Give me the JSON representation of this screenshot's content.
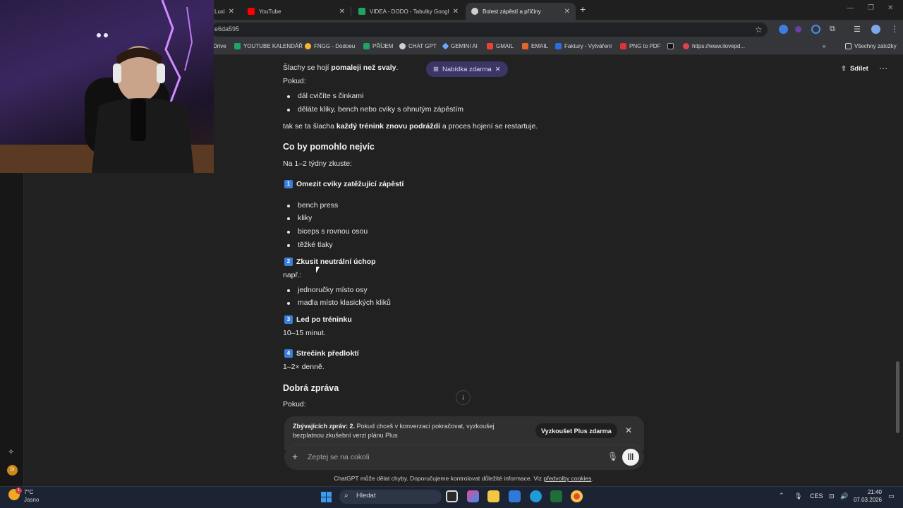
{
  "browser": {
    "tabs": [
      {
        "label": "Luxi",
        "favicon_color": "#6a6a6a"
      },
      {
        "label": "YouTube",
        "favicon_color": "#ff0000"
      },
      {
        "label": "VIDEA - DODO - Tabulky Googl",
        "favicon_color": "#1fa463"
      },
      {
        "label": "Bolest zápěstí a příčiny",
        "favicon_color": "#cfcfcf"
      }
    ],
    "address": "e6da595",
    "bookmarks": [
      {
        "label": "Drive",
        "color": "#1e88e5"
      },
      {
        "label": "YOUTUBE KALENDÁŘ",
        "color": "#1fa463"
      },
      {
        "label": "FNGG - Dodoeu",
        "color": "#f2b632"
      },
      {
        "label": "PŘÍJEM",
        "color": "#1fa463"
      },
      {
        "label": "CHAT GPT",
        "color": "#cfcfcf"
      },
      {
        "label": "GEMINI AI",
        "color": "#6ea8fe"
      },
      {
        "label": "GMAIL",
        "color": "#ea4335"
      },
      {
        "label": "EMAIL",
        "color": "#e8632a"
      },
      {
        "label": "Faktury - Vytváření",
        "color": "#2d6cdf"
      },
      {
        "label": "PNG to PDF",
        "color": "#d33"
      },
      {
        "label": "https://www.ilovepd...",
        "color": "#e04050"
      }
    ],
    "all_bookmarks": "Všechny záložky"
  },
  "topbar": {
    "offer_label": "Nabídka zdarma",
    "share_label": "Sdílet"
  },
  "chat": {
    "l1_pre": "Šlachy se hojí ",
    "l1_bold": "pomaleji než svaly",
    "l1_post": ".",
    "l2": "Pokud:",
    "bullets_a": [
      "dál cvičíte s činkami",
      "děláte kliky, bench nebo cviky s ohnutým zápěstím"
    ],
    "l3_pre": "tak se ta šlacha ",
    "l3_bold": "každý trénink znovu podráždí",
    "l3_post": " a proces hojení se restartuje.",
    "h_help": "Co by pomohlo nejvíc",
    "l4": "Na 1–2 týdny zkuste:",
    "s1_num": "1",
    "s1_title": "Omezit cviky zatěžující zápěstí",
    "bullets_b": [
      "bench press",
      "kliky",
      "biceps s rovnou osou",
      "těžké tlaky"
    ],
    "s2_num": "2",
    "s2_title": "Zkusit neutrální úchop",
    "s2_sub": "např.:",
    "bullets_c": [
      "jednoručky místo osy",
      "madla místo klasických kliků"
    ],
    "s3_num": "3",
    "s3_title": "Led po tréninku",
    "s3_sub": "10–15 minut.",
    "s4_num": "4",
    "s4_title": "Strečink předloktí",
    "s4_sub": "1–2× denně.",
    "h_good": "Dobrá zpráva",
    "l5": "Pokud:"
  },
  "composer": {
    "limit_bold": "Zbývajících zpráv: 2.",
    "limit_text": " Pokud chceš v konverzaci pokračovat, vyzkoušej bezplatnou zkušební verzi plánu Plus",
    "try_plus": "Vyzkoušet Plus zdarma",
    "placeholder": "Zeptej se na cokoli",
    "disclaimer": "ChatGPT může dělat chyby. Doporučujeme kontrolovat důležité informace. Viz ",
    "disclaimer_link": "předvolby cookies",
    "disclaimer_end": "."
  },
  "taskbar": {
    "weather_badge": "1",
    "temp": "7°C",
    "sky": "Jasno",
    "search": "Hledat",
    "lang": "CES",
    "time": "21:40",
    "date": "07.03.2026"
  },
  "sidebar": {
    "avatar_initials": "DI"
  }
}
